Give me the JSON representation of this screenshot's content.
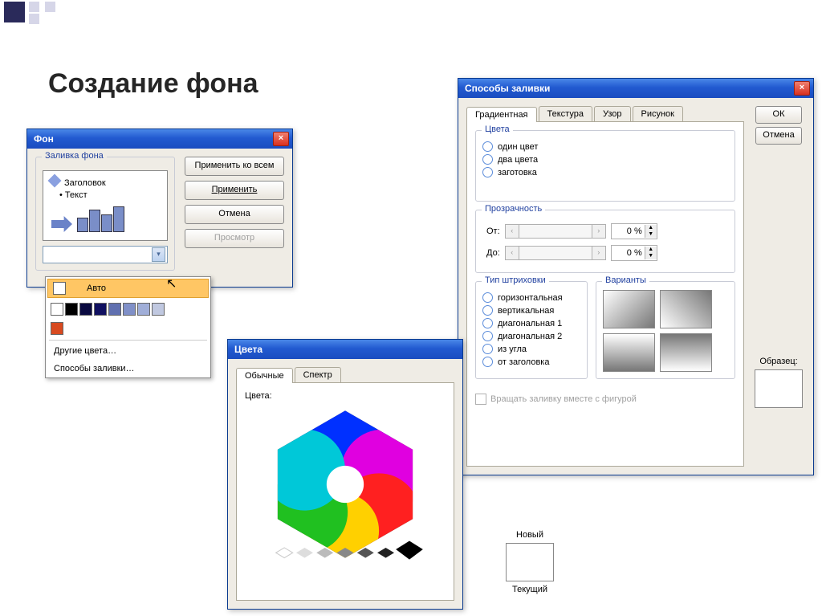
{
  "slide_title": "Создание фона",
  "bg_dialog": {
    "title": "Фон",
    "group": "Заливка фона",
    "thumb_heading": "Заголовок",
    "thumb_bullet": "Текст",
    "btn_apply_all": "Применить ко всем",
    "btn_apply": "Применить",
    "btn_cancel": "Отмена",
    "btn_preview": "Просмотр"
  },
  "color_popup": {
    "auto": "Авто",
    "more": "Другие цвета…",
    "fill_methods": "Способы заливки…",
    "swatches1": [
      "#ffffff",
      "#000000",
      "#0a0a40",
      "#101060",
      "#6070b0",
      "#8090c8",
      "#a0aed8",
      "#c0c8e0"
    ],
    "swatches2": [
      "#d84a20"
    ]
  },
  "colors_dialog": {
    "title": "Цвета",
    "tab_standard": "Обычные",
    "tab_spectrum": "Спектр",
    "label": "Цвета:",
    "new": "Новый",
    "current": "Текущий"
  },
  "fill_dialog": {
    "title": "Способы заливки",
    "tabs": {
      "gradient": "Градиентная",
      "texture": "Текстура",
      "pattern": "Узор",
      "picture": "Рисунок"
    },
    "btn_ok": "ОК",
    "btn_cancel": "Отмена",
    "grp_colors": "Цвета",
    "radios_colors": {
      "one": "один цвет",
      "two": "два цвета",
      "preset": "заготовка"
    },
    "grp_trans": "Прозрачность",
    "from": "От:",
    "to": "До:",
    "pct": "0 %",
    "grp_shade": "Тип штриховки",
    "radios_shade": {
      "h": "горизонтальная",
      "v": "вертикальная",
      "d1": "диагональная 1",
      "d2": "диагональная 2",
      "c": "из угла",
      "t": "от заголовка"
    },
    "grp_variants": "Варианты",
    "sample": "Образец:",
    "rotate": "Вращать заливку вместе с фигурой"
  }
}
